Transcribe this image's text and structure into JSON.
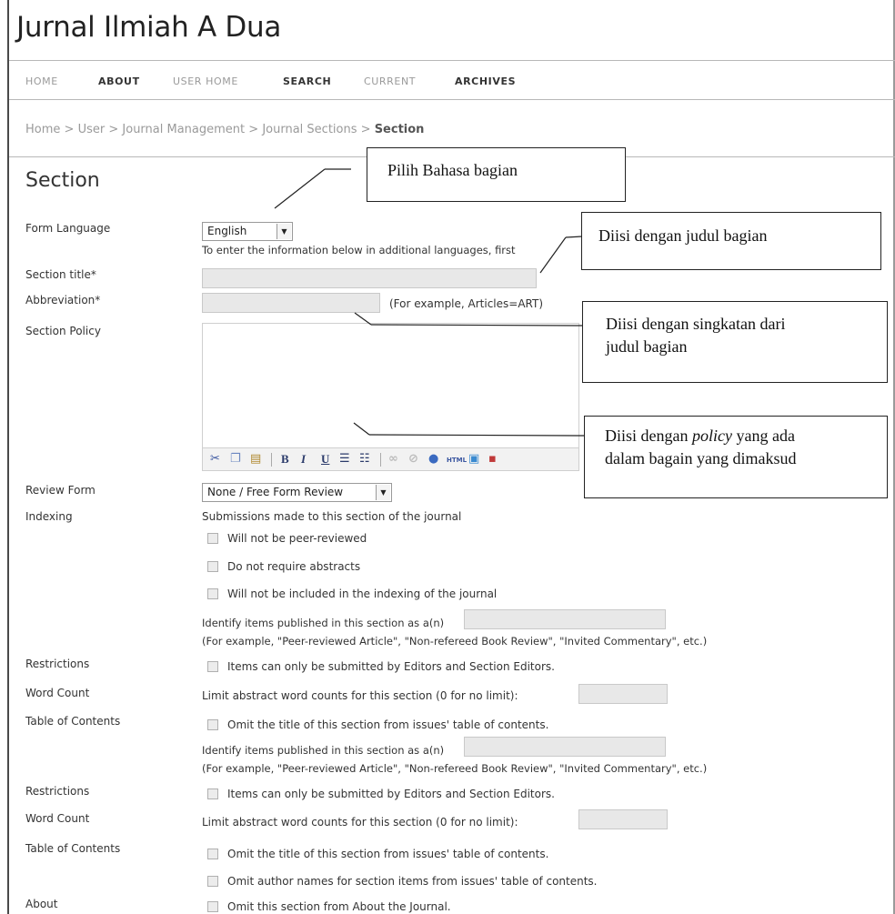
{
  "site": {
    "title": "Jurnal Ilmiah A Dua"
  },
  "nav": {
    "home": "HOME",
    "about": "ABOUT",
    "user_home": "USER HOME",
    "search": "SEARCH",
    "current": "CURRENT",
    "archives": "ARCHIVES"
  },
  "breadcrumb": {
    "items": [
      "Home",
      "User",
      "Journal Management",
      "Journal Sections"
    ],
    "current": "Section",
    "separator": ">"
  },
  "page": {
    "heading": "Section"
  },
  "form": {
    "form_language": {
      "label": "Form Language",
      "value": "English",
      "help": "To enter the information below in additional languages, first"
    },
    "section_title": {
      "label": "Section title*",
      "value": ""
    },
    "abbreviation": {
      "label": "Abbreviation*",
      "value": "",
      "hint": "(For example, Articles=ART)"
    },
    "section_policy": {
      "label": "Section Policy",
      "value": ""
    },
    "review_form": {
      "label": "Review Form",
      "value": "None / Free Form Review"
    },
    "indexing": {
      "label": "Indexing",
      "intro": "Submissions made to this section of the journal",
      "opt_not_peer_reviewed": "Will not be peer-reviewed",
      "opt_no_abstracts": "Do not require abstracts",
      "opt_not_indexed": "Will not be included in the indexing of the journal",
      "identify_label": "Identify items published in this section as a(n)",
      "identify_example": "(For example, \"Peer-reviewed Article\", \"Non-refereed Book Review\", \"Invited Commentary\", etc.)"
    },
    "restrictions": {
      "label": "Restrictions",
      "option": "Items can only be submitted by Editors and Section Editors."
    },
    "word_count": {
      "label": "Word Count",
      "text": "Limit abstract word counts for this section (0 for no limit):"
    },
    "toc": {
      "label": "Table of Contents",
      "omit_title": "Omit the title of this section from issues' table of contents.",
      "omit_authors": "Omit author names for section items from issues' table of contents."
    },
    "about": {
      "label": "About",
      "option": "Omit this section from About the Journal."
    }
  },
  "toolbar": {
    "bold": "B",
    "italic": "I",
    "underline": "U"
  },
  "callouts": {
    "language": "Pilih Bahasa bagian",
    "title": "Diisi dengan judul bagian",
    "abbrev_line1": "Diisi dengan singkatan dari",
    "abbrev_line2": "judul bagian",
    "policy_pre": "Diisi dengan ",
    "policy_em": "policy",
    "policy_post": " yang ada",
    "policy_line2": "dalam bagain yang dimaksud"
  }
}
